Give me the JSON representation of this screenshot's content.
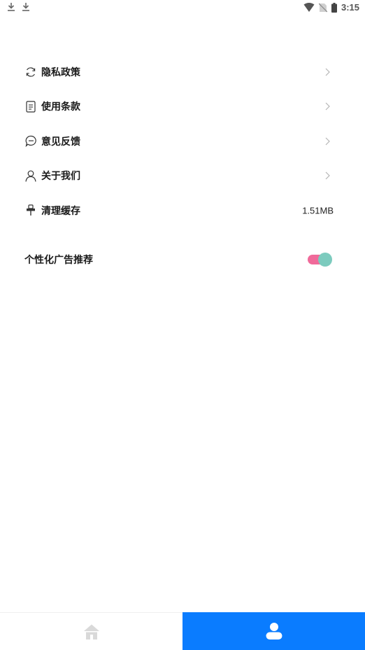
{
  "status_bar": {
    "time": "3:15",
    "icons": [
      "download-icon",
      "download-icon",
      "wifi-icon",
      "no-sim-icon",
      "battery-icon"
    ]
  },
  "menu": {
    "items": [
      {
        "label": "隐私政策",
        "icon": "refresh-circle-icon",
        "has_chevron": true
      },
      {
        "label": "使用条款",
        "icon": "document-icon",
        "has_chevron": true
      },
      {
        "label": "意见反馈",
        "icon": "chat-bubble-icon",
        "has_chevron": true
      },
      {
        "label": "关于我们",
        "icon": "person-outline-icon",
        "has_chevron": true
      },
      {
        "label": "清理缓存",
        "icon": "broom-icon",
        "value": "1.51MB"
      }
    ]
  },
  "ad_setting": {
    "label": "个性化广告推荐",
    "enabled": true
  },
  "bottom_nav": {
    "tabs": [
      {
        "icon": "home-icon",
        "active": false
      },
      {
        "icon": "user-icon",
        "active": true
      }
    ]
  },
  "colors": {
    "accent": "#0a7cff",
    "toggle_track": "#f06a9a",
    "toggle_knob": "#7ccbbe",
    "inactive_icon": "#d9d9d9"
  }
}
